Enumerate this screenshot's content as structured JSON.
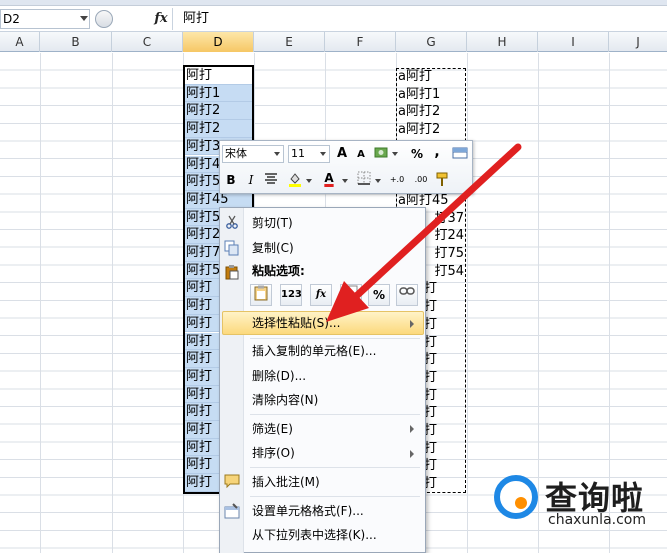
{
  "formula_bar": {
    "name_box": "D2",
    "fx_label": "fx",
    "content": "阿打"
  },
  "columns": [
    "A",
    "B",
    "C",
    "D",
    "E",
    "F",
    "G",
    "H",
    "I",
    "J"
  ],
  "column_d_cells": [
    "阿打",
    "阿打1",
    "阿打2",
    "阿打2",
    "阿打3",
    "阿打4",
    "阿打5",
    "阿打45",
    "阿打5",
    "阿打2",
    "阿打7",
    "阿打5",
    "阿打",
    "阿打",
    "阿打",
    "阿打",
    "阿打",
    "阿打",
    "阿打",
    "阿打",
    "阿打",
    "阿打",
    "阿打",
    "阿打"
  ],
  "column_g_cells": [
    "a阿打",
    "a阿打1",
    "a阿打2",
    "a阿打2",
    "",
    "",
    "",
    "a阿打45",
    "打37",
    "打24",
    "打75",
    "打54",
    "打",
    "打",
    "打",
    "打",
    "打",
    "打",
    "打",
    "打",
    "打",
    "打",
    "打",
    "打"
  ],
  "mini_toolbar": {
    "font_name": "宋体",
    "font_size": "11",
    "grow_font": "A",
    "shrink_font": "A",
    "percent": "%",
    "comma": ",",
    "bold": "B",
    "italic": "I",
    "font_color_letter": "A",
    "increase_decimal": "+.0",
    "decrease_decimal": ".00"
  },
  "context_menu": {
    "cut": "剪切(T)",
    "copy": "复制(C)",
    "paste_options": "粘贴选项:",
    "paste_values": "123",
    "paste_formulas": "fx",
    "paste_percent": "%",
    "paste_special": "选择性粘贴(S)...",
    "insert_copied": "插入复制的单元格(E)...",
    "delete": "删除(D)...",
    "clear_contents": "清除内容(N)",
    "filter": "筛选(E)",
    "sort": "排序(O)",
    "insert_comment": "插入批注(M)",
    "format_cells": "设置单元格格式(F)...",
    "pick_from_list": "从下拉列表中选择(K)..."
  },
  "watermark": {
    "title": "查询啦",
    "subtitle": "chaxunla.com"
  },
  "colors": {
    "selection_fill": "#c6dcf3",
    "menu_highlight": "#fcd97d",
    "arrow": "#e02020",
    "watermark_blue": "#1e88e5",
    "watermark_orange": "#ff8f00"
  }
}
